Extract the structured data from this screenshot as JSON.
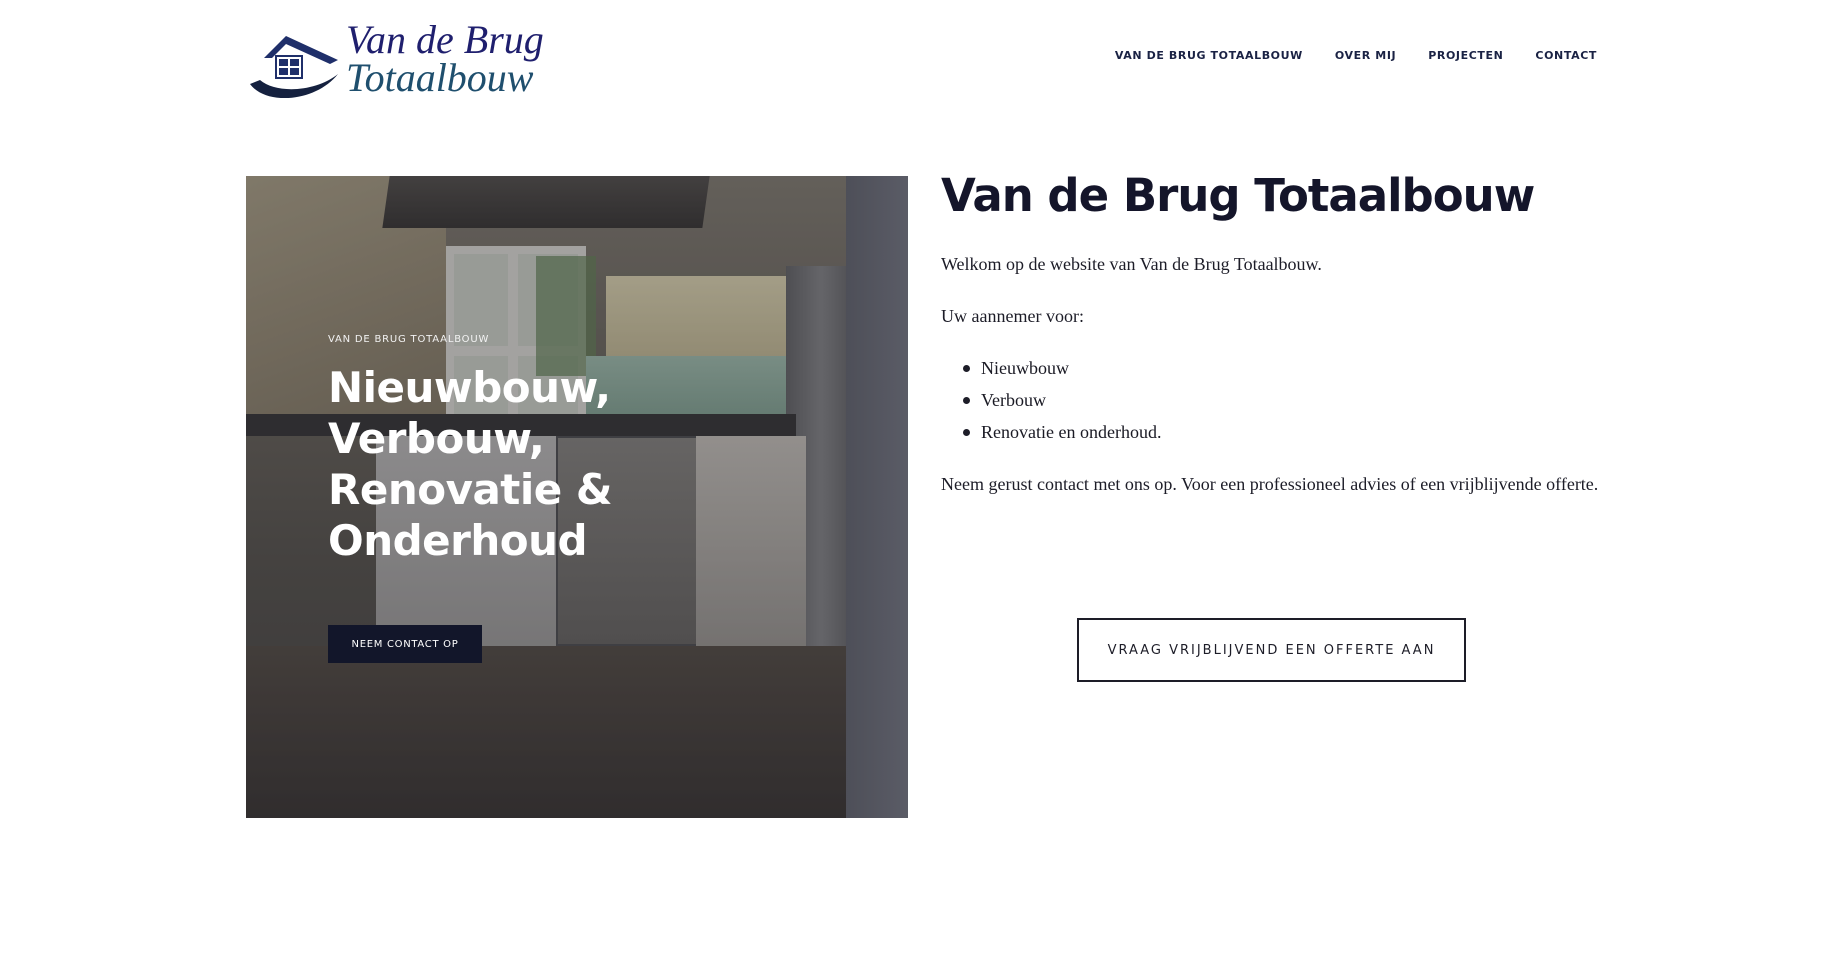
{
  "logo": {
    "line1": "Van de Brug",
    "line2": "Totaalbouw",
    "icon": "house-logo-icon"
  },
  "nav": {
    "items": [
      {
        "label": "VAN DE BRUG TOTAALBOUW"
      },
      {
        "label": "OVER MIJ"
      },
      {
        "label": "PROJECTEN"
      },
      {
        "label": "CONTACT"
      }
    ]
  },
  "hero": {
    "eyebrow": "VAN DE BRUG TOTAALBOUW",
    "headline": [
      "Nieuwbouw,",
      "Verbouw,",
      "Renovatie &",
      "Onderhoud"
    ],
    "cta_label": "NEEM CONTACT OP"
  },
  "content": {
    "title": "Van de Brug Totaalbouw",
    "welcome": "Welkom op de website van Van de Brug Totaalbouw.",
    "intro": "Uw aannemer voor:",
    "services": [
      "Nieuwbouw",
      "Verbouw",
      "Renovatie en onderhoud."
    ],
    "closing": "Neem gerust contact met ons op. Voor een professioneel advies of een vrijblijvende offerte."
  },
  "offer": {
    "label": "VRAAG VRIJBLIJVEND EEN OFFERTE AAN"
  },
  "colors": {
    "navy": "#1a2244",
    "cta_dark": "#12162a",
    "text": "#1d1d28"
  }
}
